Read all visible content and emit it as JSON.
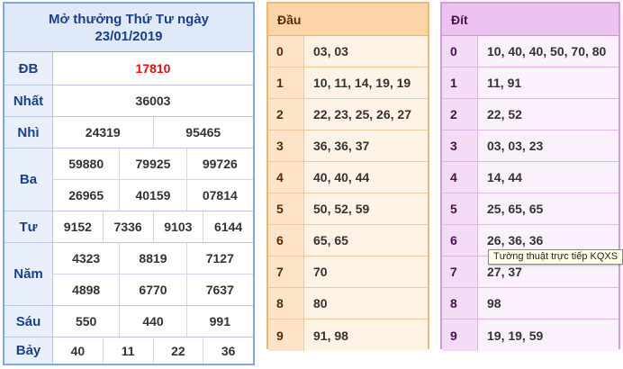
{
  "results": {
    "title": "Mở thưởng Thứ Tư ngày",
    "date": "23/01/2019",
    "rows": [
      {
        "label": "ĐB",
        "lines": [
          [
            "17810"
          ]
        ]
      },
      {
        "label": "Nhất",
        "lines": [
          [
            "36003"
          ]
        ]
      },
      {
        "label": "Nhì",
        "lines": [
          [
            "24319",
            "95465"
          ]
        ]
      },
      {
        "label": "Ba",
        "lines": [
          [
            "59880",
            "79925",
            "99726"
          ],
          [
            "26965",
            "40159",
            "07814"
          ]
        ]
      },
      {
        "label": "Tư",
        "lines": [
          [
            "9152",
            "7336",
            "9103",
            "6144"
          ]
        ]
      },
      {
        "label": "Năm",
        "lines": [
          [
            "4323",
            "8819",
            "7127"
          ],
          [
            "4898",
            "6770",
            "7637"
          ]
        ]
      },
      {
        "label": "Sáu",
        "lines": [
          [
            "550",
            "440",
            "991"
          ]
        ]
      },
      {
        "label": "Bảy",
        "lines": [
          [
            "40",
            "11",
            "22",
            "36"
          ]
        ]
      }
    ]
  },
  "dau": {
    "title": "Đầu",
    "rows": [
      {
        "num": "0",
        "val": "03, 03"
      },
      {
        "num": "1",
        "val": "10, 11, 14, 19, 19"
      },
      {
        "num": "2",
        "val": "22, 23, 25, 26, 27"
      },
      {
        "num": "3",
        "val": "36, 36, 37"
      },
      {
        "num": "4",
        "val": "40, 40, 44"
      },
      {
        "num": "5",
        "val": "50, 52, 59"
      },
      {
        "num": "6",
        "val": "65, 65"
      },
      {
        "num": "7",
        "val": "70"
      },
      {
        "num": "8",
        "val": "80"
      },
      {
        "num": "9",
        "val": "91, 98"
      }
    ]
  },
  "dit": {
    "title": "Đít",
    "rows": [
      {
        "num": "0",
        "val": "10, 40, 40, 50, 70, 80"
      },
      {
        "num": "1",
        "val": "11, 91"
      },
      {
        "num": "2",
        "val": "22, 52"
      },
      {
        "num": "3",
        "val": "03, 03, 23"
      },
      {
        "num": "4",
        "val": "14, 44"
      },
      {
        "num": "5",
        "val": "25, 65, 65"
      },
      {
        "num": "6",
        "val": "26, 36, 36"
      },
      {
        "num": "7",
        "val": "27, 37"
      },
      {
        "num": "8",
        "val": "98"
      },
      {
        "num": "9",
        "val": "19, 19, 59"
      }
    ]
  },
  "tooltip": "Tường thuật trực tiếp KQXS",
  "colors": {
    "special_prize": "#e01010",
    "results_border": "#7fa7e2",
    "dau_border": "#f2b573",
    "dit_border": "#d79ae0"
  }
}
